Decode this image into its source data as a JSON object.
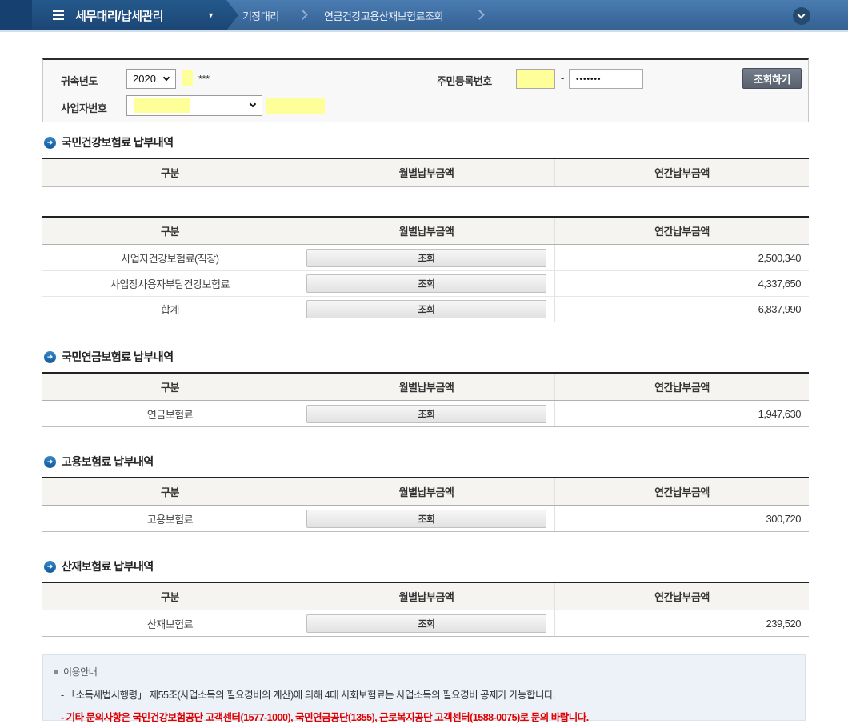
{
  "nav": {
    "menu_label": "세무대리/납세관리",
    "breadcrumb_1": "기장대리",
    "breadcrumb_2": "연금건강고용산재보험료조회"
  },
  "form": {
    "year_label": "귀속년도",
    "year_value": "2020",
    "year_masked_text": "***",
    "rrn_label": "주민등록번호",
    "rrn_dash": "-",
    "rrn_back_masked": "•••••••",
    "business_label": "사업자번호",
    "search_button_label": "조회하기"
  },
  "table_headers": {
    "col1": "구분",
    "col2": "월별납부금액",
    "col3": "연간납부금액"
  },
  "lookup_button_label": "조회",
  "sections": [
    {
      "title": "국민건강보험료 납부내역",
      "empty_table": true,
      "rows": [
        {
          "label": "사업자건강보험료(직장)",
          "annual": "2,500,340"
        },
        {
          "label": "사업장사용자부담건강보험료",
          "annual": "4,337,650"
        },
        {
          "label": "합계",
          "annual": "6,837,990"
        }
      ]
    },
    {
      "title": "국민연금보험료 납부내역",
      "empty_table": false,
      "rows": [
        {
          "label": "연금보험료",
          "annual": "1,947,630"
        }
      ]
    },
    {
      "title": "고용보험료 납부내역",
      "empty_table": false,
      "rows": [
        {
          "label": "고용보험료",
          "annual": "300,720"
        }
      ]
    },
    {
      "title": "산재보험료 납부내역",
      "empty_table": false,
      "rows": [
        {
          "label": "산재보험료",
          "annual": "239,520"
        }
      ]
    }
  ],
  "notice": {
    "title": "이용안내",
    "line1": "- 「소득세법시행령」 제55조(사업소득의 필요경비의 계산)에 의해 4대 사회보험료는 사업소득의 필요경비 공제가 가능합니다.",
    "line2": "- 기타 문의사항은 국민건강보험공단 고객센터(1577-1000), 국민연금공단(1355), 근로복지공단 고객센터(1588-0075)로 문의 바랍니다."
  },
  "colors": {
    "nav_blue": "#3a689c",
    "nav_dark_segment": "#1e4d7f",
    "highlight_yellow": "#ffff99",
    "alert_red": "#e00000",
    "section_icon_blue": "#11599c"
  }
}
